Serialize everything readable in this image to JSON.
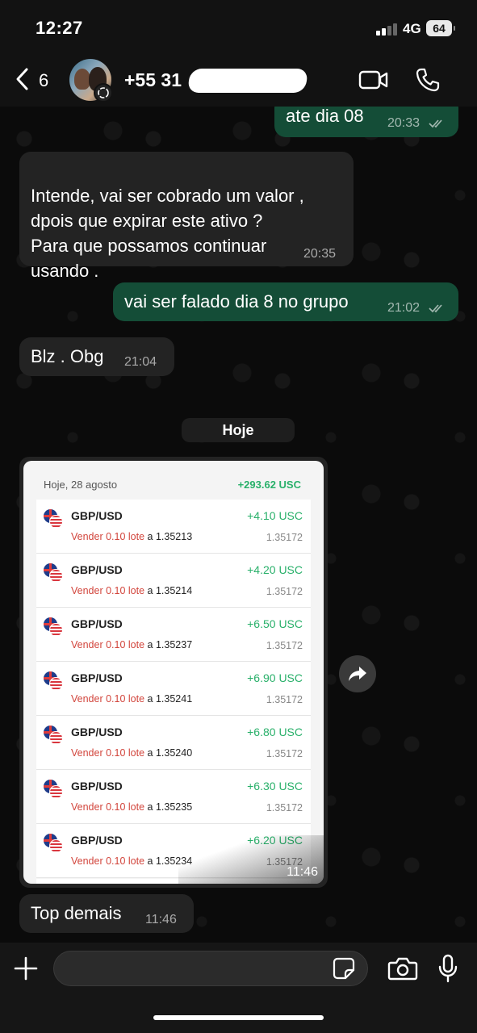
{
  "status_bar": {
    "time": "12:27",
    "network": "4G",
    "battery": "64"
  },
  "header": {
    "back_count": "6",
    "contact_name": "+55 31"
  },
  "messages": [
    {
      "text": "ate dia 08",
      "time": "20:33",
      "direction": "out"
    },
    {
      "text": "Intende,  vai ser cobrado um valor ,\ndpois que expirar este ativo ?\nPara que possamos continuar\nusando .",
      "time": "20:35",
      "direction": "in"
    },
    {
      "text": "vai ser falado dia 8 no grupo",
      "time": "21:02",
      "direction": "out"
    },
    {
      "text": "Blz . Obg",
      "time": "21:04",
      "direction": "in"
    },
    {
      "text": "Top demais",
      "time": "11:46",
      "direction": "in"
    }
  ],
  "day_separator": "Hoje",
  "image_message": {
    "time": "11:46",
    "card_date": "Hoje, 28 agosto",
    "card_total": "+293.62 USC",
    "trades": [
      {
        "pair": "GBP/USD",
        "action": "Vender 0.10 lote",
        "at": "a 1.35213",
        "profit": "+4.10 USC",
        "price": "1.35172"
      },
      {
        "pair": "GBP/USD",
        "action": "Vender 0.10 lote",
        "at": "a 1.35214",
        "profit": "+4.20 USC",
        "price": "1.35172"
      },
      {
        "pair": "GBP/USD",
        "action": "Vender 0.10 lote",
        "at": "a 1.35237",
        "profit": "+6.50 USC",
        "price": "1.35172"
      },
      {
        "pair": "GBP/USD",
        "action": "Vender 0.10 lote",
        "at": "a 1.35241",
        "profit": "+6.90 USC",
        "price": "1.35172"
      },
      {
        "pair": "GBP/USD",
        "action": "Vender 0.10 lote",
        "at": "a 1.35240",
        "profit": "+6.80 USC",
        "price": "1.35172"
      },
      {
        "pair": "GBP/USD",
        "action": "Vender 0.10 lote",
        "at": "a 1.35235",
        "profit": "+6.30 USC",
        "price": "1.35172"
      },
      {
        "pair": "GBP/USD",
        "action": "Vender 0.10 lote",
        "at": "a 1.35234",
        "profit": "+6.20 USC",
        "price": "1.35172"
      }
    ]
  },
  "icons": {
    "back": "chevron-left-icon",
    "video": "video-call-icon",
    "phone": "phone-call-icon",
    "forward": "forward-icon",
    "plus": "plus-icon",
    "sticker": "sticker-icon",
    "camera": "camera-icon",
    "mic": "microphone-icon"
  },
  "colors": {
    "outgoing_bubble": "#144d37",
    "incoming_bubble": "#232323",
    "profit_green": "#29b06a",
    "sell_red": "#d2453c"
  }
}
